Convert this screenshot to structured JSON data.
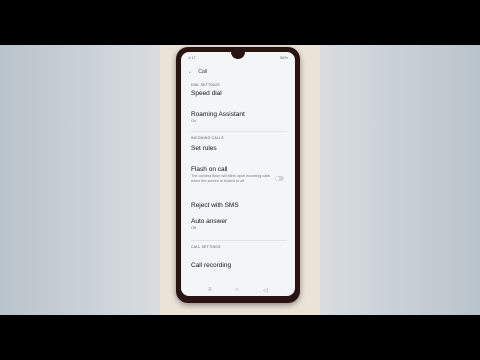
{
  "status": {
    "time": "1:17",
    "battery": "56%"
  },
  "app": {
    "title": "Call"
  },
  "sections": {
    "dial": "DIAL SETTINGS",
    "incoming": "INCOMING CALLS",
    "call": "CALL SETTINGS"
  },
  "items": {
    "speed_dial": "Speed dial",
    "roaming_title": "Roaming Assistant",
    "roaming_sub": "On",
    "set_rules": "Set rules",
    "flash_title": "Flash on call",
    "flash_sub": "The camera flash will blink upon incoming calls when the screen is locked or off",
    "reject_sms": "Reject with SMS",
    "auto_title": "Auto answer",
    "auto_sub": "Off",
    "call_recording": "Call recording"
  },
  "icons": {
    "back": "back-arrow-icon",
    "nav_recents": "recents-icon",
    "nav_home": "home-icon",
    "nav_back": "nav-back-icon"
  }
}
